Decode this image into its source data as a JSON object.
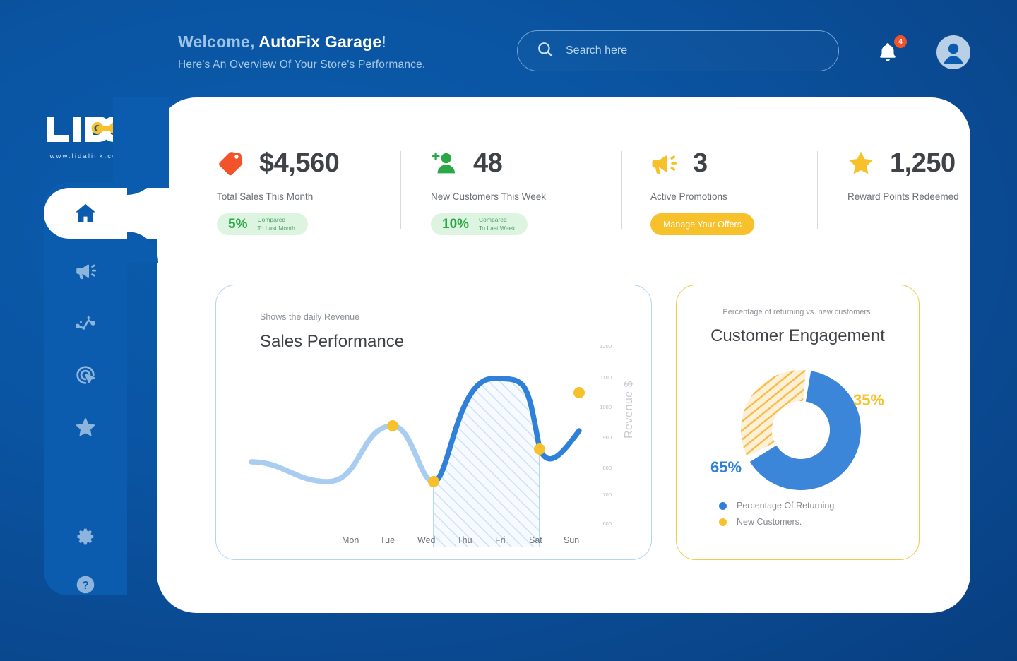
{
  "header": {
    "welcome_prefix": "Welcome, ",
    "store_name": "AutoFix Garage",
    "welcome_suffix": "!",
    "subtitle": "Here's An Overview Of Your Store's Performance.",
    "search_placeholder": "Search here",
    "search_value": "",
    "search_icon": "search-icon",
    "notification_icon": "bell-icon",
    "notification_count": "4",
    "avatar_icon": "user-avatar-icon"
  },
  "brand": {
    "logo_text": "LIDA",
    "logo_url": "www.lidalink.com"
  },
  "sidebar": {
    "items": [
      {
        "icon": "home-icon",
        "name": "sidebar-item-home",
        "active": true
      },
      {
        "icon": "megaphone-icon",
        "name": "sidebar-item-promotions",
        "active": false
      },
      {
        "icon": "analytics-icon",
        "name": "sidebar-item-analytics",
        "active": false
      },
      {
        "icon": "target-cursor-icon",
        "name": "sidebar-item-targeting",
        "active": false
      },
      {
        "icon": "star-icon",
        "name": "sidebar-item-rewards",
        "active": false
      }
    ],
    "bottom_items": [
      {
        "icon": "gear-icon",
        "name": "sidebar-item-settings"
      },
      {
        "icon": "help-circle-icon",
        "name": "sidebar-item-help"
      }
    ]
  },
  "kpis": [
    {
      "icon": "price-tag-icon",
      "icon_color": "#f2532a",
      "value": "$4,560",
      "label": "Total Sales This Month",
      "badge_pct": "5%",
      "badge_line1": "Compared",
      "badge_line2": "To Last Month"
    },
    {
      "icon": "add-user-icon",
      "icon_color": "#2aa845",
      "value": "48",
      "label": "New Customers This Week",
      "badge_pct": "10%",
      "badge_line1": "Compared",
      "badge_line2": "To Last Week"
    },
    {
      "icon": "megaphone-icon",
      "icon_color": "#f7c12c",
      "value": "3",
      "label": "Active Promotions",
      "button_label": "Manage Your Offers"
    },
    {
      "icon": "star-icon",
      "icon_color": "#f7c12c",
      "value": "1,250",
      "label": "Reward Points Redeemed"
    }
  ],
  "chart_data": [
    {
      "type": "area",
      "title": "Sales Performance",
      "subtitle": "Shows the daily Revenue",
      "xlabel": "",
      "ylabel": "Revenue $",
      "categories": [
        "Mon",
        "Tue",
        "Wed",
        "Thu",
        "Fri",
        "Sat",
        "Sun"
      ],
      "values": [
        820,
        960,
        790,
        1180,
        1180,
        870,
        1030
      ],
      "yticks": [
        "1200",
        "1100",
        "1000",
        "900",
        "800",
        "700",
        "600"
      ],
      "ylim": [
        600,
        1200
      ],
      "grid": false,
      "legend_position": "none",
      "series": [
        {
          "name": "Daily Revenue",
          "values": [
            820,
            960,
            790,
            1180,
            1180,
            870,
            1030
          ]
        }
      ],
      "markers": [
        "Tue",
        "Wed",
        "Sat",
        "Sun"
      ],
      "highlight_range": [
        "Wed",
        "Sat"
      ],
      "line_color": "#2f80d8",
      "line_color_muted": "#a8cdf0",
      "marker_color": "#f7c12c"
    },
    {
      "type": "pie",
      "title": "Customer Engagement",
      "subtitle": "Percentage of returning vs. new customers.",
      "labels": [
        "Percentage Of Returning",
        "New Customers."
      ],
      "values": [
        65,
        35
      ],
      "value_labels": [
        "65%",
        "35%"
      ],
      "colors": [
        "#3b86d8",
        "#f7b940"
      ],
      "legend_position": "bottom-left",
      "donut": true
    }
  ]
}
